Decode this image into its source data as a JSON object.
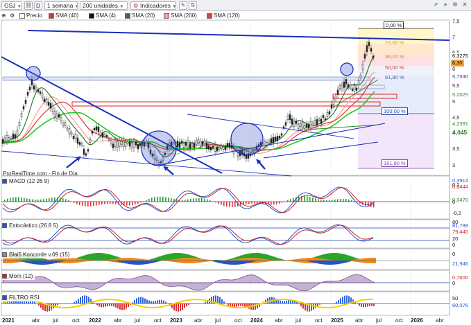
{
  "toolbar": {
    "symbol": "GSJ",
    "draw_label": "D",
    "period": "1 semana",
    "units": "200 unidades",
    "indicators": "Indicadores"
  },
  "legend": [
    {
      "name": "Precio",
      "color": "#ffffff"
    },
    {
      "name": "SMA (40)",
      "color": "#e03030"
    },
    {
      "name": "SMA (4)",
      "color": "#111111"
    },
    {
      "name": "SMA (20)",
      "color": "#2a7a2a"
    },
    {
      "name": "SMA (200)",
      "color": "#ff9999"
    },
    {
      "name": "SMA (120)",
      "color": "#e04040"
    }
  ],
  "source": "ProRealTime.com - Fin de Día",
  "price_axis": {
    "ticks": [
      "7,5",
      "7",
      "6,5",
      "6",
      "5,5",
      "5",
      "4,5",
      "4",
      "3,5",
      "3"
    ],
    "tags": [
      {
        "text": "6,3275",
        "color": "#ffffff",
        "text_color": "#000000"
      },
      {
        "text": "6,30",
        "color": "#f2a640",
        "text_color": "#000000"
      },
      {
        "text": "5,7530",
        "color": "#ffffff",
        "text_color": "#334488"
      },
      {
        "text": "5,2025",
        "color": "#ffffff",
        "text_color": "#2a8a2a"
      },
      {
        "text": "4,2391",
        "color": "#ffffff",
        "text_color": "#2a8a2a"
      },
      {
        "text": "4,045",
        "color": "#ffffff",
        "text_color": "#2a7a2a"
      }
    ]
  },
  "fib_levels": [
    {
      "text": "0,00 %"
    },
    {
      "text": "23,60 %"
    },
    {
      "text": "38,20 %"
    },
    {
      "text": "50,00 %"
    },
    {
      "text": "61,80 %"
    },
    {
      "text": "100,00 %"
    },
    {
      "text": "161,80 %"
    }
  ],
  "indicators": [
    {
      "id": "macd",
      "title": "MACD (12 26 9)",
      "ticks": [
        "0,2",
        "0",
        "-0,2"
      ],
      "tags": [
        {
          "text": "0,3914",
          "color": "#2255cc"
        },
        {
          "text": "0,3444",
          "color": "#cc2222"
        },
        {
          "text": "0,0470",
          "color": "#2a8a2a"
        }
      ]
    },
    {
      "id": "stoch",
      "title": "Estocástico (26 8 5)",
      "ticks": [
        "80",
        "20",
        "0"
      ],
      "tags": [
        {
          "text": "81,788",
          "color": "#2255cc"
        },
        {
          "text": "79,440",
          "color": "#cc2222"
        }
      ]
    },
    {
      "id": "koncorde",
      "title": "Blai5 Koncorde v.09 (15)",
      "ticks": [
        "0"
      ],
      "tags": [
        {
          "text": "21,946",
          "color": "#2255cc"
        }
      ]
    },
    {
      "id": "mom",
      "title": "Mom (12)",
      "ticks": [
        "0"
      ],
      "tags": [
        {
          "text": "0,7600",
          "color": "#cc2222"
        }
      ]
    },
    {
      "id": "rsi",
      "title": "FILTRO RSI",
      "ticks": [
        "50"
      ],
      "tags": [
        {
          "text": "60,076",
          "color": "#2255cc"
        }
      ]
    }
  ],
  "x_axis": [
    {
      "text": "2021",
      "year": true
    },
    {
      "text": "abr"
    },
    {
      "text": "jul"
    },
    {
      "text": "oct"
    },
    {
      "text": "2022",
      "year": true
    },
    {
      "text": "abr"
    },
    {
      "text": "jul"
    },
    {
      "text": "oct"
    },
    {
      "text": "2023",
      "year": true
    },
    {
      "text": "abr"
    },
    {
      "text": "jul"
    },
    {
      "text": "oct"
    },
    {
      "text": "2024",
      "year": true
    },
    {
      "text": "abr"
    },
    {
      "text": "jul"
    },
    {
      "text": "oct"
    },
    {
      "text": "2025",
      "year": true
    },
    {
      "text": "abr"
    },
    {
      "text": "jul"
    },
    {
      "text": "oct"
    },
    {
      "text": "2026",
      "year": true
    },
    {
      "text": "abr"
    }
  ]
}
